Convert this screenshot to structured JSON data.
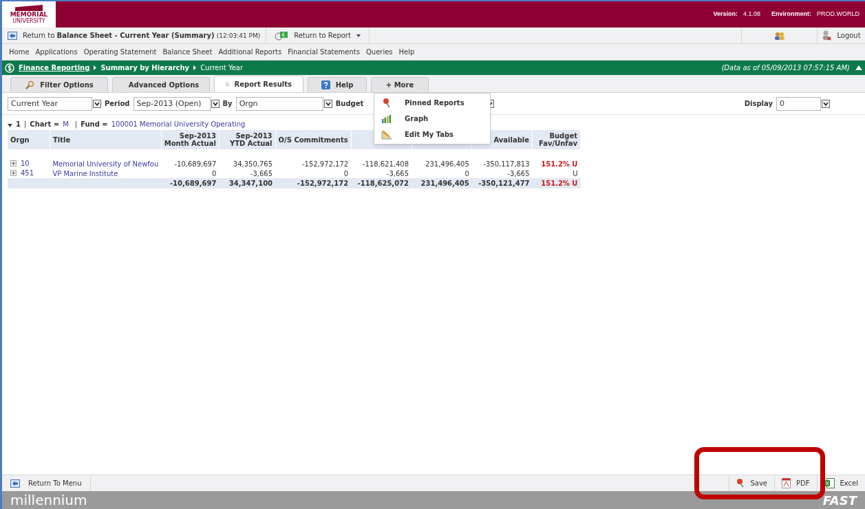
{
  "header": {
    "version_label": "Version:",
    "version": "4.1.08",
    "environment_label": "Environment:",
    "environment": "PROD.WORLD",
    "logo_text": "MEMORIAL",
    "logo_sub": "UNIVERSITY"
  },
  "toolbar": {
    "return_prefix": "Return to",
    "return_target": "Balance Sheet - Current Year (Summary)",
    "return_time": "(12:03:41 PM)",
    "return_report": "Return to Report",
    "logout": "Logout"
  },
  "menu": [
    "Home",
    "Applications",
    "Operating Statement",
    "Balance Sheet",
    "Additional Reports",
    "Financial Statements",
    "Queries",
    "Help"
  ],
  "breadcrumb": {
    "items": [
      "Finance Reporting",
      "Summary by Hierarchy",
      "Current Year"
    ],
    "data_as_of": "(Data as of 05/09/2013 07:57:15 AM)"
  },
  "tabs": [
    {
      "label": "Filter Options",
      "kind": "filter",
      "selected": false
    },
    {
      "label": "Advanced Options",
      "kind": "advanced",
      "selected": false
    },
    {
      "label": "Report Results",
      "kind": "report",
      "selected": true
    },
    {
      "label": "Help",
      "kind": "help",
      "selected": false
    },
    {
      "label": "+ More",
      "kind": "more",
      "selected": false
    }
  ],
  "more_menu": [
    {
      "label": "Pinned Reports",
      "kind": "pin"
    },
    {
      "label": "Graph",
      "kind": "graph"
    },
    {
      "label": "Edit My Tabs",
      "kind": "edit"
    }
  ],
  "filters": {
    "year": "Current Year",
    "period_label": "Period",
    "period": "Sep-2013 (Open)",
    "by_label": "By",
    "by": "Orgn",
    "budget_label": "Budget",
    "display_label": "Display",
    "display": "0"
  },
  "group_line": {
    "level": "1",
    "separator": "|",
    "chart_label": "Chart =",
    "chart": "M",
    "fund_label": "Fund =",
    "fund": "100001 Memorial University Operating"
  },
  "table": {
    "columns": [
      {
        "label": "Orgn"
      },
      {
        "label": "Title"
      },
      {
        "label": "Sep-2013\nMonth Actual"
      },
      {
        "label": "Sep-2013\nYTD Actual"
      },
      {
        "label": "O/S Commitments"
      },
      {
        "covered": true
      },
      {
        "covered": true
      },
      {
        "label": "Available"
      },
      {
        "label": "Budget\nFav/Unfav"
      }
    ],
    "rows": [
      {
        "cells": [
          "10",
          "Memorial University of Newfou",
          "-10,689,697",
          "34,350,765",
          "-152,972,172",
          "-118,621,408",
          "231,496,405",
          "-350,117,813",
          "151.2% U"
        ],
        "alert": true
      },
      {
        "cells": [
          "451",
          "VP Marine Institute",
          "0",
          "-3,665",
          "0",
          "-3,665",
          "0",
          "-3,665",
          "U"
        ],
        "alert": false
      }
    ],
    "total": {
      "cells": [
        "-10,689,697",
        "34,347,100",
        "-152,972,172",
        "-118,625,072",
        "231,496,405",
        "-350,121,477"
      ],
      "fav": "151.2% U",
      "alert": true
    }
  },
  "footer": {
    "return_menu": "Return To Menu",
    "actions": [
      {
        "label": "Save",
        "kind": "save"
      },
      {
        "label": "PDF",
        "kind": "pdf"
      },
      {
        "label": "Excel",
        "kind": "excel"
      }
    ],
    "brand": "millennium",
    "brand_right": "FAST"
  }
}
